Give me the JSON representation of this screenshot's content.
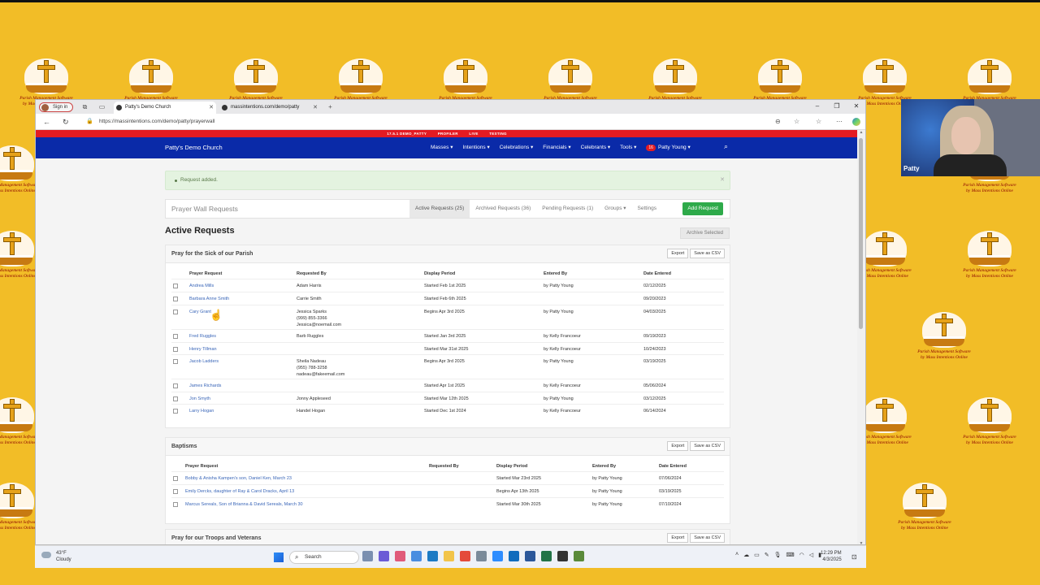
{
  "logo_caption": [
    "Parish Management Software",
    "by Mass Intentions Online"
  ],
  "browser": {
    "signin": "Sign in",
    "tabs": [
      {
        "title": "Patty's Demo Church",
        "active": true
      },
      {
        "title": "massintentions.com/demo/patty",
        "active": false
      }
    ],
    "url": "https://massintentions.com/demo/patty/prayerwall"
  },
  "env_bar": [
    "17.5.1 DEMO_PATTY",
    "PROFILER",
    "LIVE",
    "TESTING"
  ],
  "nav": {
    "brand": "Patty's Demo Church",
    "menu": [
      "Masses ▾",
      "Intentions ▾",
      "Celebrations ▾",
      "Financials ▾",
      "Celebrants ▾",
      "Tools ▾"
    ],
    "user_badge": "16",
    "user": "Patty Young ▾"
  },
  "alert": "Request added.",
  "toolbar": {
    "title": "Prayer Wall Requests",
    "tabs": [
      "Active Requests (25)",
      "Archived Requests (36)",
      "Pending Requests (1)",
      "Groups ▾",
      "Settings"
    ],
    "add": "Add Request"
  },
  "heading": "Active Requests",
  "archive_selected": "Archive Selected",
  "export": "Export",
  "save_csv": "Save as CSV",
  "columns": [
    "Prayer Request",
    "Requested By",
    "Display Period",
    "Entered By",
    "Date Entered"
  ],
  "groups": [
    {
      "title": "Pray for the Sick of our Parish",
      "rows": [
        {
          "request": "Andrea Mills",
          "by": [
            "Adam Harris"
          ],
          "period": "Started Feb 1st 2025",
          "entered": "by Patty Young",
          "date": "02/12/2025"
        },
        {
          "request": "Barbara Anne Smith",
          "by": [
            "Carrie Smith"
          ],
          "period": "Started Feb 6th 2025",
          "entered": "",
          "date": "09/20/2023"
        },
        {
          "request": "Cary Grant",
          "by": [
            "Jessica Sparks",
            "(999) 855-3366",
            "Jessica@noemail.com"
          ],
          "period": "Begins Apr 3rd 2025",
          "entered": "by Patty Young",
          "date": "04/03/2025"
        },
        {
          "request": "Fred Ruggles",
          "by": [
            "Barb Ruggles"
          ],
          "period": "Started Jan 3rd 2025",
          "entered": "by Kelly Francoeur",
          "date": "09/19/2023"
        },
        {
          "request": "Henry Tillman",
          "by": [
            ""
          ],
          "period": "Started Mar 31st 2025",
          "entered": "by Kelly Francoeur",
          "date": "10/24/2023"
        },
        {
          "request": "Jacob Ladders",
          "by": [
            "Sheila Nadeau",
            "(955) 788-3258",
            "nadeau@fakeemail.com"
          ],
          "period": "Begins Apr 3rd 2025",
          "entered": "by Patty Young",
          "date": "03/19/2025"
        },
        {
          "request": "James Richards",
          "by": [
            ""
          ],
          "period": "Started Apr 1st 2025",
          "entered": "by Kelly Francoeur",
          "date": "05/06/2024"
        },
        {
          "request": "Jon Smyth",
          "by": [
            "Jonny Appleseed"
          ],
          "period": "Started Mar 12th 2025",
          "entered": "by Patty Young",
          "date": "03/12/2025"
        },
        {
          "request": "Larry Hogan",
          "by": [
            "Handel Hogan"
          ],
          "period": "Started Dec 1st 2024",
          "entered": "by Kelly Francoeur",
          "date": "06/14/2024"
        }
      ]
    },
    {
      "title": "Baptisms",
      "rows": [
        {
          "request": "Bobby & Anisha Kampen's son, Daniel Ken, March 23",
          "by": [
            ""
          ],
          "period": "Started Mar 23rd 2025",
          "entered": "by Patty Young",
          "date": "07/06/2024"
        },
        {
          "request": "Emily Dercks, daughter of Ray & Carol Dracks, April 13",
          "by": [
            ""
          ],
          "period": "Begins Apr 13th 2025",
          "entered": "by Patty Young",
          "date": "03/19/2025"
        },
        {
          "request": "Marcus Sereals, Son of Brianna & David Sereals, March 30",
          "by": [
            ""
          ],
          "period": "Started Mar 30th 2025",
          "entered": "by Patty Young",
          "date": "07/10/2024"
        }
      ]
    },
    {
      "title": "Pray for our Troops and Veterans",
      "rows": []
    }
  ],
  "taskbar": {
    "temp": "43°F",
    "weather": "Cloudy",
    "search": "Search",
    "time": "12:29 PM",
    "date": "4/3/2025"
  },
  "webcam": {
    "name": "Patty"
  }
}
